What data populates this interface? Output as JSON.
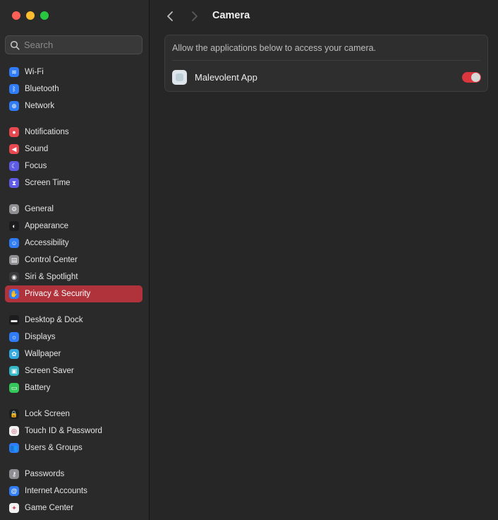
{
  "window": {
    "controls": [
      "close",
      "minimize",
      "zoom"
    ]
  },
  "search": {
    "placeholder": "Search",
    "value": ""
  },
  "sidebar": {
    "items": [
      {
        "label": "Wi-Fi",
        "icon": "wifi-icon",
        "color": "#2f7cf6",
        "glyph": "≋"
      },
      {
        "label": "Bluetooth",
        "icon": "bluetooth-icon",
        "color": "#2f7cf6",
        "glyph": "ᛒ"
      },
      {
        "label": "Network",
        "icon": "globe-icon",
        "color": "#2f7cf6",
        "glyph": "⊕"
      },
      {
        "label": "Notifications",
        "icon": "bell-icon",
        "color": "#e8484f",
        "glyph": "●"
      },
      {
        "label": "Sound",
        "icon": "speaker-icon",
        "color": "#e8484f",
        "glyph": "◀"
      },
      {
        "label": "Focus",
        "icon": "moon-icon",
        "color": "#5e5ce6",
        "glyph": "☾"
      },
      {
        "label": "Screen Time",
        "icon": "hourglass-icon",
        "color": "#5e5ce6",
        "glyph": "⧗"
      },
      {
        "label": "General",
        "icon": "gear-icon",
        "color": "#8e8e93",
        "glyph": "⚙"
      },
      {
        "label": "Appearance",
        "icon": "appearance-icon",
        "color": "#1c1c1e",
        "glyph": "◐"
      },
      {
        "label": "Accessibility",
        "icon": "accessibility-icon",
        "color": "#2f7cf6",
        "glyph": "☺"
      },
      {
        "label": "Control Center",
        "icon": "control-center-icon",
        "color": "#8e8e93",
        "glyph": "▤"
      },
      {
        "label": "Siri & Spotlight",
        "icon": "siri-icon",
        "color": "#3a3a3c",
        "glyph": "◉"
      },
      {
        "label": "Privacy & Security",
        "icon": "hand-icon",
        "color": "#2f7cf6",
        "glyph": "✋",
        "active": true
      },
      {
        "label": "Desktop & Dock",
        "icon": "dock-icon",
        "color": "#1c1c1e",
        "glyph": "▬"
      },
      {
        "label": "Displays",
        "icon": "sun-icon",
        "color": "#2f7cf6",
        "glyph": "☼"
      },
      {
        "label": "Wallpaper",
        "icon": "wallpaper-icon",
        "color": "#34a8e0",
        "glyph": "✿"
      },
      {
        "label": "Screen Saver",
        "icon": "screen-saver-icon",
        "color": "#34b8c8",
        "glyph": "▣"
      },
      {
        "label": "Battery",
        "icon": "battery-icon",
        "color": "#34c759",
        "glyph": "▭"
      },
      {
        "label": "Lock Screen",
        "icon": "lock-icon",
        "color": "#1c1c1e",
        "glyph": "🔒"
      },
      {
        "label": "Touch ID & Password",
        "icon": "fingerprint-icon",
        "color": "#f2f2f2",
        "glyph": "◎"
      },
      {
        "label": "Users & Groups",
        "icon": "users-icon",
        "color": "#2f7cf6",
        "glyph": "👥"
      },
      {
        "label": "Passwords",
        "icon": "key-icon",
        "color": "#8e8e93",
        "glyph": "⚷"
      },
      {
        "label": "Internet Accounts",
        "icon": "at-icon",
        "color": "#2f7cf6",
        "glyph": "@"
      },
      {
        "label": "Game Center",
        "icon": "game-center-icon",
        "color": "#f2f2f2",
        "glyph": "✦"
      }
    ]
  },
  "main": {
    "title": "Camera",
    "description": "Allow the applications below to access your camera.",
    "apps": [
      {
        "name": "Malevolent App",
        "enabled": true
      }
    ]
  },
  "colors": {
    "accent": "#b0323b",
    "toggle_on": "#d9363e"
  }
}
